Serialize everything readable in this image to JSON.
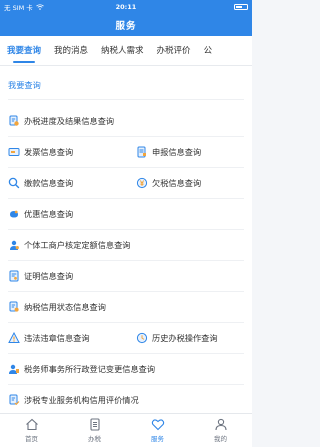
{
  "status": {
    "carrier": "无 SIM 卡",
    "time": "20:11"
  },
  "header": {
    "title": "服务"
  },
  "tabs": [
    {
      "label": "我要查询"
    },
    {
      "label": "我的消息"
    },
    {
      "label": "纳税人需求"
    },
    {
      "label": "办税评价"
    },
    {
      "label": "公"
    }
  ],
  "section": {
    "title": "我要查询"
  },
  "items": {
    "progress": "办税进度及结果信息查询",
    "invoice": "发票信息查询",
    "declare": "申报信息查询",
    "payment": "缴款信息查询",
    "arrears": "欠税信息查询",
    "discount": "优惠信息查询",
    "quota": "个体工商户核定定额信息查询",
    "certificate": "证明信息查询",
    "credit": "纳税信用状态信息查询",
    "violation": "违法违章信息查询",
    "history": "历史办税操作查询",
    "agency": "税务师事务所行政登记变更信息查询",
    "service_eval": "涉税专业服务机构信用评价情况"
  },
  "tabbar": [
    {
      "label": "首页"
    },
    {
      "label": "办税"
    },
    {
      "label": "服务"
    },
    {
      "label": "我的"
    }
  ],
  "colors": {
    "accent": "#2f86e7"
  }
}
